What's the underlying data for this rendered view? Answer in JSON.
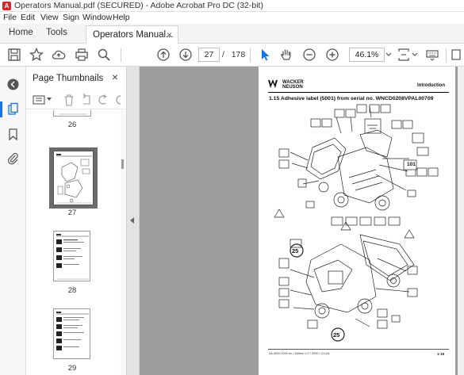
{
  "window": {
    "title": "Operators Manual.pdf (SECURED) - Adobe Acrobat Pro DC (32-bit)"
  },
  "menu": [
    "File",
    "Edit",
    "View",
    "Sign",
    "Window",
    "Help"
  ],
  "tabs": {
    "home": "Home",
    "tools": "Tools",
    "document": "Operators Manual...",
    "close_glyph": "×"
  },
  "toolbar": {
    "current_page": "27",
    "page_separator": "/",
    "total_pages": "178",
    "zoom": "46.1%"
  },
  "panel": {
    "title": "Page Thumbnails",
    "close_glyph": "×",
    "thumbnails": [
      {
        "page": "26"
      },
      {
        "page": "27"
      },
      {
        "page": "28"
      },
      {
        "page": "29"
      }
    ]
  },
  "document_page": {
    "logo_line1": "WACKER",
    "logo_line2": "NEUSON",
    "section": "Introduction",
    "heading": "1.15 Adhesive label (5001) from serial no. WNCD0208VPAL00709",
    "footer_left": "0A-0000 0000 en • Edition 2.0 * 0000 • 01.0/e",
    "footer_right": "1-19",
    "label_numbers": [
      "25",
      "25"
    ],
    "small_label": "101",
    "accent_color": "#1473e6"
  }
}
